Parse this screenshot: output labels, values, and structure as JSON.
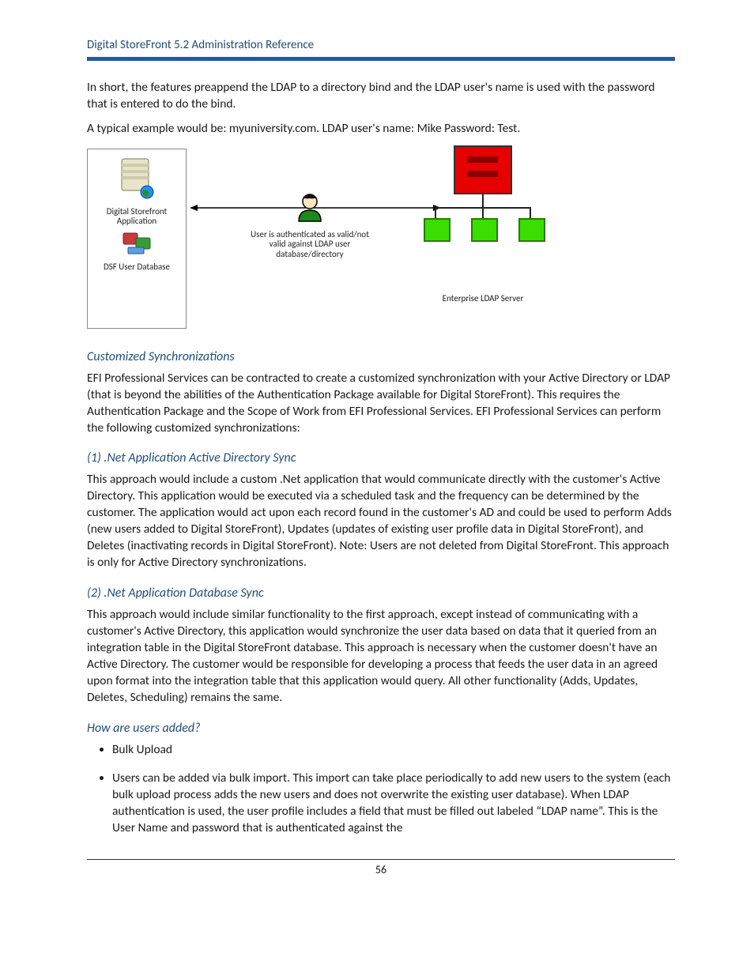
{
  "doc_title": "Digital StoreFront 5.2 Administration Reference",
  "page_number": "56",
  "paragraphs": {
    "intro1": "In short, the features preappend the LDAP to a directory bind and the LDAP user's name is used with the password that is entered to do the bind.",
    "intro2": "A typical example would be: myuniversity.com. LDAP user's name: Mike Password: Test.",
    "custom_sync": "EFI Professional Services can be contracted to create a customized synchronization with your Active Directory or LDAP (that is beyond the abilities of the Authentication Package available for Digital StoreFront). This requires the Authentication Package and the Scope of Work from EFI Professional Services. EFI Professional Services can perform the following customized synchronizations:",
    "net_ad_sync": "This approach would include a custom .Net application that would communicate directly with the customer's Active Directory. This application would be executed via a scheduled task and the frequency can be determined by the customer. The application would act upon each record found in the customer's AD and could be used to perform Adds (new users added to Digital StoreFront), Updates (updates of existing user profile data in Digital StoreFront), and Deletes (inactivating records in Digital StoreFront). Note: Users are not deleted from Digital StoreFront. This approach is only for Active Directory synchronizations.",
    "net_db_sync": "This approach would include similar functionality to the first approach, except instead of communicating with a customer's Active Directory, this application would synchronize the user data based on data that it queried from an integration table in the Digital StoreFront database. This approach is necessary when the customer doesn't have an Active Directory. The customer would be responsible for developing a process that feeds the user data in an agreed upon format into the integration table that this application would query. All other functionality (Adds, Updates, Deletes, Scheduling) remains the same."
  },
  "headings": {
    "h1": "Customized Synchronizations",
    "h2": "(1) .Net Application Active Directory Sync",
    "h3": "(2) .Net Application Database Sync",
    "h4": "How are users added?"
  },
  "bullets": {
    "b1": "Bulk Upload",
    "b2": "Users can be added via bulk import. This import can take place periodically to add new users to the system (each bulk upload process adds the new users and does not overwrite the existing user database). When LDAP authentication is used, the user profile includes a field that must be filled out labeled “LDAP name”. This is the User Name and password that is authenticated against the"
  },
  "diagram": {
    "dsf_app": "Digital Storefront Application",
    "dsf_db": "DSF User Database",
    "user_caption": "User is authenticated as valid/not valid against LDAP user database/directory",
    "ldap_label": "Enterprise LDAP Server"
  }
}
